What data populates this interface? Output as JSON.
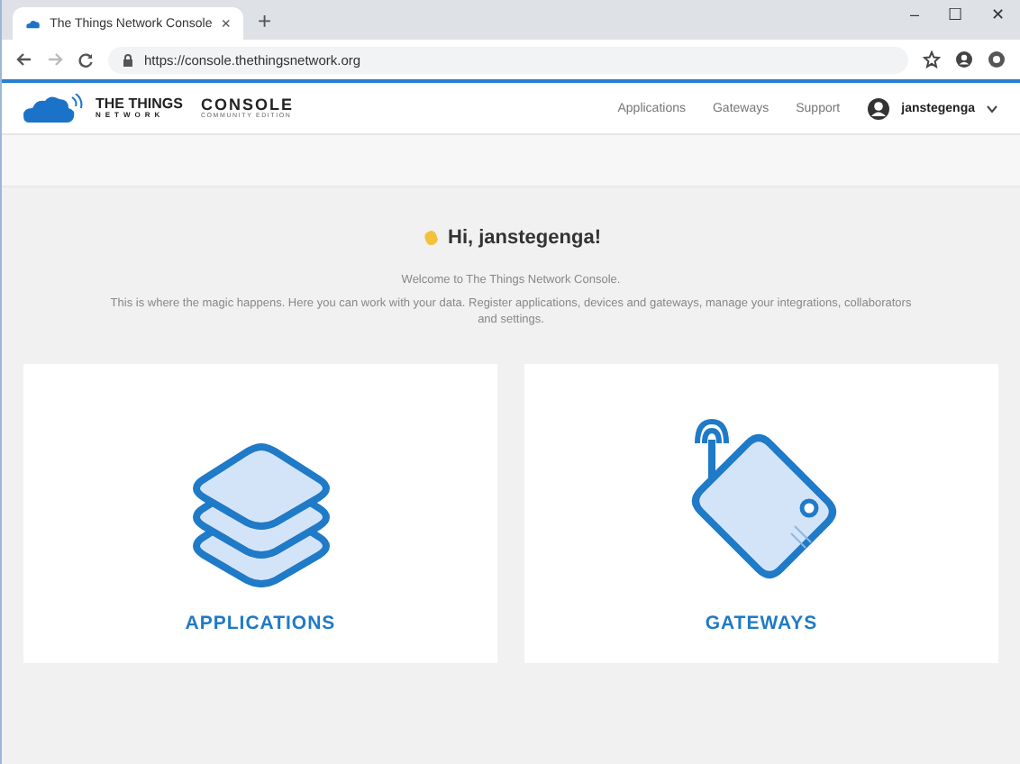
{
  "browser": {
    "tab_title": "The Things Network Console",
    "tab_close": "×",
    "new_tab": "+",
    "url": "https://console.thethingsnetwork.org",
    "window_controls": [
      "–",
      "☐",
      "✕"
    ]
  },
  "header": {
    "logo_line1": "THE THINGS",
    "logo_line2": "NETWORK",
    "product": "CONSOLE",
    "edition": "COMMUNITY EDITION",
    "nav": [
      {
        "label": "Applications"
      },
      {
        "label": "Gateways"
      },
      {
        "label": "Support"
      }
    ],
    "user": "janstegenga"
  },
  "greeting": "Hi, janstegenga!",
  "welcome": "Welcome to The Things Network Console.",
  "intro": "This is where the magic happens. Here you can work with your data. Register applications, devices and gateways, manage your integrations, collaborators and settings.",
  "cards": [
    {
      "kind": "applications",
      "label": "APPLICATIONS"
    },
    {
      "kind": "gateways",
      "label": "GATEWAYS"
    }
  ]
}
